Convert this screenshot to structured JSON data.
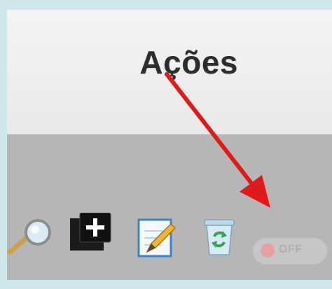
{
  "header": {
    "title": "Ações"
  },
  "actions": {
    "view_icon": "magnifier-icon",
    "add_icon": "add-icon",
    "edit_icon": "edit-icon",
    "recycle_icon": "recycle-bin-icon",
    "toggle": {
      "label": "OFF",
      "state": "off"
    }
  },
  "colors": {
    "header_bg": "#efefef",
    "body_bg": "#b6b6b6",
    "arrow": "#e01a1a",
    "toggle_knob": "#e7a0a0"
  }
}
